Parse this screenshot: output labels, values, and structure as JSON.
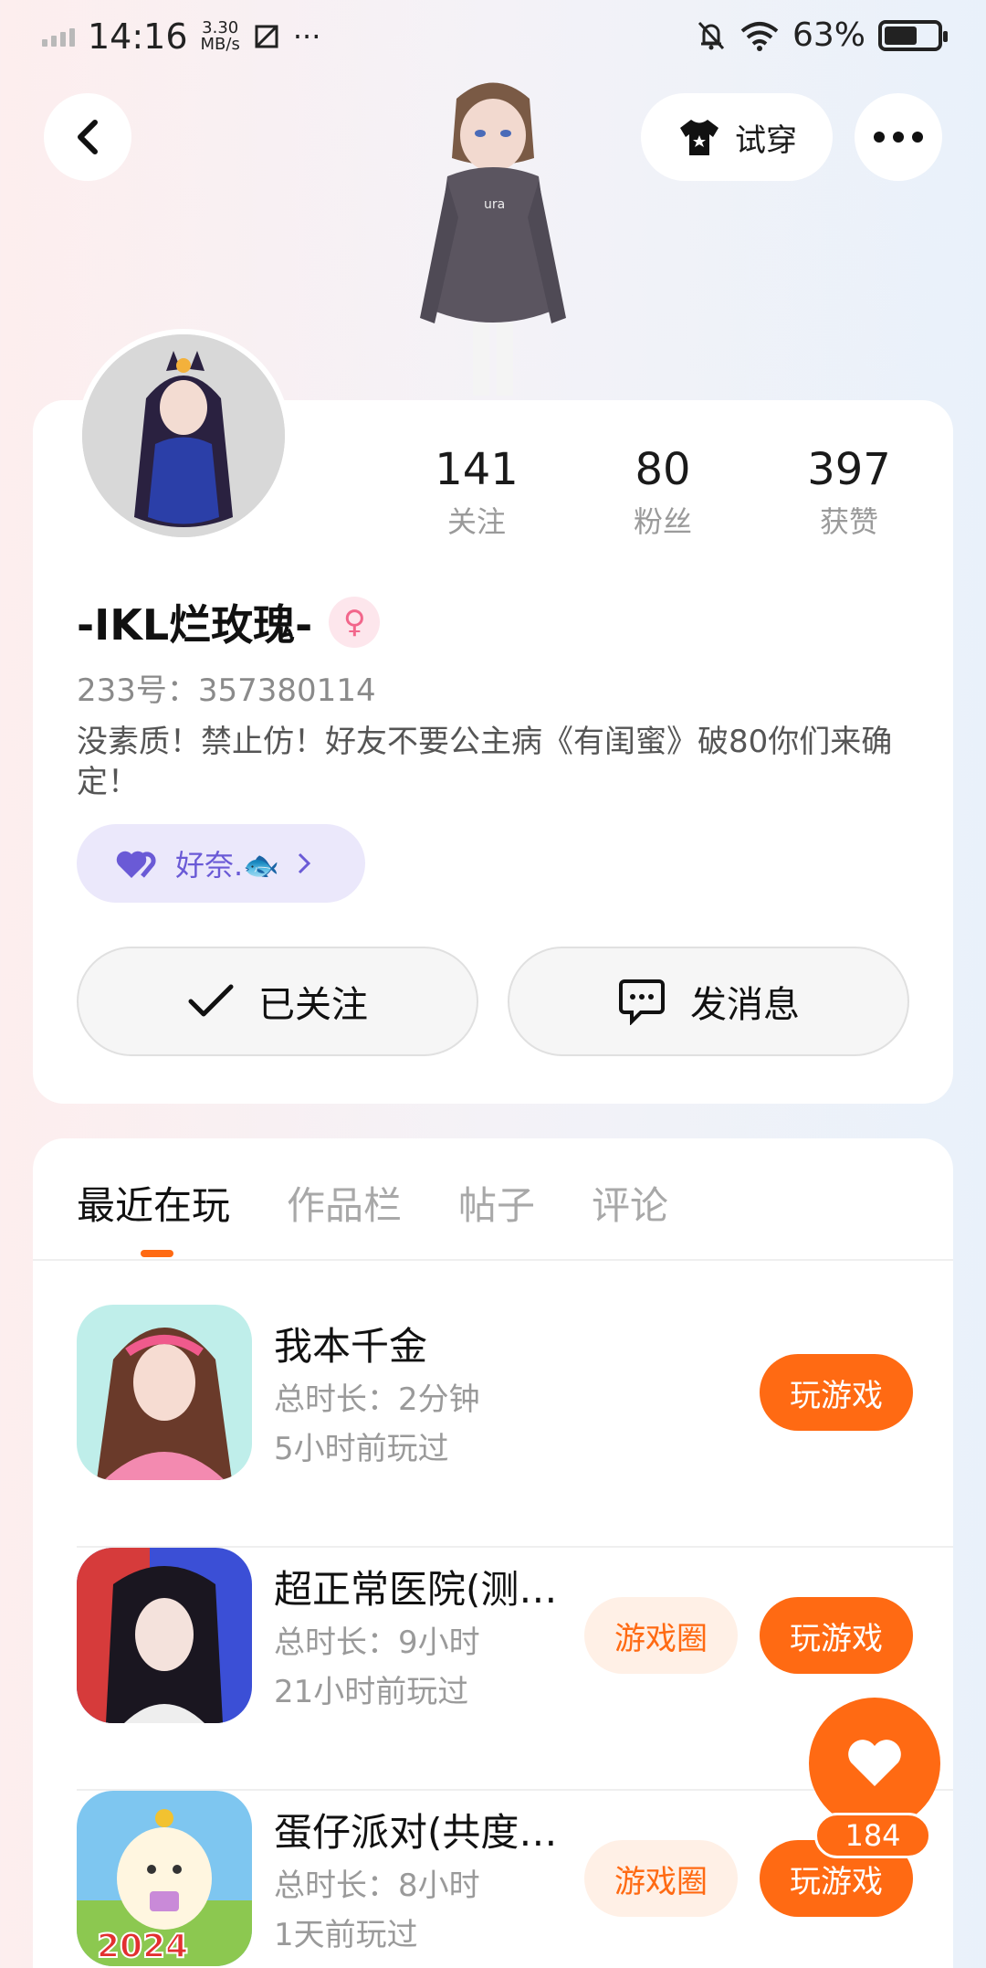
{
  "status_bar": {
    "time": "14:16",
    "speed_value": "3.30",
    "speed_unit": "MB/s",
    "more": "···",
    "battery": "63%"
  },
  "nav": {
    "tryon_label": "试穿"
  },
  "profile": {
    "stats": [
      {
        "num": "141",
        "label": "关注"
      },
      {
        "num": "80",
        "label": "粉丝"
      },
      {
        "num": "397",
        "label": "获赞"
      }
    ],
    "name": "-IKL烂玫瑰-",
    "gender_symbol": "♀",
    "uid": "233号：357380114",
    "bio": "没素质！禁止仿！好友不要公主病《有闺蜜》破80你们来确定！",
    "friend_chip": "好奈.🐟",
    "follow_label": "已关注",
    "message_label": "发消息"
  },
  "tabs": [
    "最近在玩",
    "作品栏",
    "帖子",
    "评论"
  ],
  "games": [
    {
      "title": "我本千金",
      "duration": "总时长：2分钟",
      "last_played": "5小时前玩过",
      "play_label": "玩游戏",
      "circle_label": ""
    },
    {
      "title": "超正常医院(测…",
      "duration": "总时长：9小时",
      "last_played": "21小时前玩过",
      "play_label": "玩游戏",
      "circle_label": "游戏圈"
    },
    {
      "title": "蛋仔派对(共度…",
      "duration": "总时长：8小时",
      "last_played": "1天前玩过",
      "play_label": "玩游戏",
      "circle_label": "游戏圈"
    }
  ],
  "game3_badge": "2024",
  "like_count": "184",
  "colors": {
    "accent": "#ff6a13",
    "friend_chip_bg": "#ebe8fb"
  }
}
